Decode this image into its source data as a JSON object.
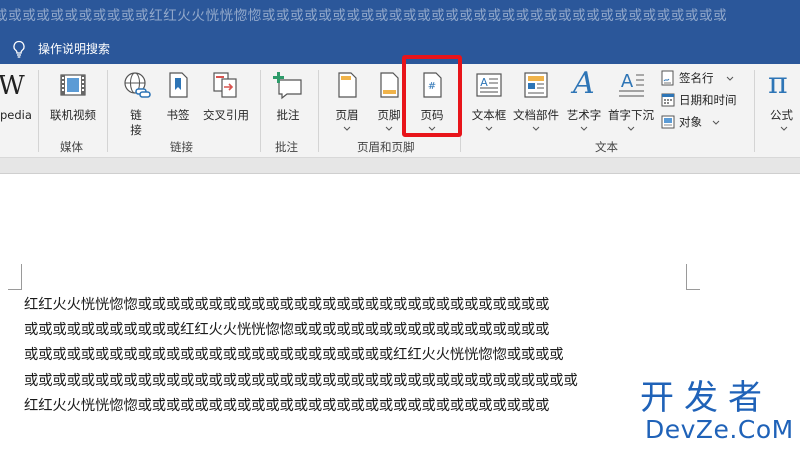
{
  "titlebar": {
    "text": "或或或或或或或或或或或红红火火恍恍惚惚或或或或或或或或或或或或或或或或或或或或或或或或或或或或或或或或或"
  },
  "tellme": {
    "label": "操作说明搜索",
    "icon": "lightbulb-icon"
  },
  "ribbon": {
    "wikipedia": {
      "icon": "wikipedia-icon",
      "glyph": "W",
      "label": "pedia"
    },
    "media": {
      "group_label": "媒体",
      "online_video": {
        "label": "联机视频",
        "icon": "film-icon"
      }
    },
    "links": {
      "group_label": "链接",
      "link": {
        "label_line1": "链",
        "label_line2": "接",
        "icon": "globe-link-icon"
      },
      "bookmark": {
        "label": "书签",
        "icon": "bookmark-icon"
      },
      "cross_ref": {
        "label": "交叉引用",
        "icon": "cross-reference-icon"
      }
    },
    "comments": {
      "group_label": "批注",
      "comment": {
        "label": "批注",
        "icon": "comment-add-icon"
      }
    },
    "header_footer": {
      "group_label": "页眉和页脚",
      "header": {
        "label": "页眉",
        "icon": "header-icon"
      },
      "footer": {
        "label": "页脚",
        "icon": "footer-icon"
      },
      "page_number": {
        "label": "页码",
        "icon": "page-number-icon",
        "glyph": "#"
      }
    },
    "text": {
      "group_label": "文本",
      "textbox": {
        "label": "文本框",
        "icon": "textbox-icon",
        "glyph": "A"
      },
      "quick_parts": {
        "label": "文档部件",
        "icon": "quick-parts-icon"
      },
      "wordart": {
        "label": "艺术字",
        "icon": "wordart-icon",
        "glyph": "A"
      },
      "dropcap": {
        "label": "首字下沉",
        "icon": "drop-cap-icon",
        "glyph": "A"
      },
      "signature": {
        "label": "签名行",
        "icon": "signature-line-icon"
      },
      "datetime": {
        "label": "日期和时间",
        "icon": "date-time-icon"
      },
      "object": {
        "label": "对象",
        "icon": "object-icon"
      }
    },
    "symbols": {
      "equation": {
        "label": "公式",
        "icon": "pi-icon",
        "glyph": "π"
      }
    }
  },
  "document": {
    "lines": [
      "红红火火恍恍惚惚或或或或或或或或或或或或或或或或或或或或或或或或或或或或或",
      "或或或或或或或或或或或红红火火恍恍惚惚或或或或或或或或或或或或或或或或或或",
      "或或或或或或或或或或或或或或或或或或或或或或或或或或红红火火恍恍惚惚或或或或",
      "或或或或或或或或或或或或或或或或或或或或或或或或或或或或或或或或或或或或或或或",
      "红红火火恍恍惚惚或或或或或或或或或或或或或或或或或或或或或或或或或或或或或"
    ]
  },
  "watermark": {
    "chinese": "开发者",
    "english": "DevZe.CoM"
  },
  "colors": {
    "title_blue": "#2b579a",
    "highlight_red": "#e8141a",
    "watermark_blue": "#1f62b8",
    "ribbon_bg": "#f3f3f3"
  }
}
